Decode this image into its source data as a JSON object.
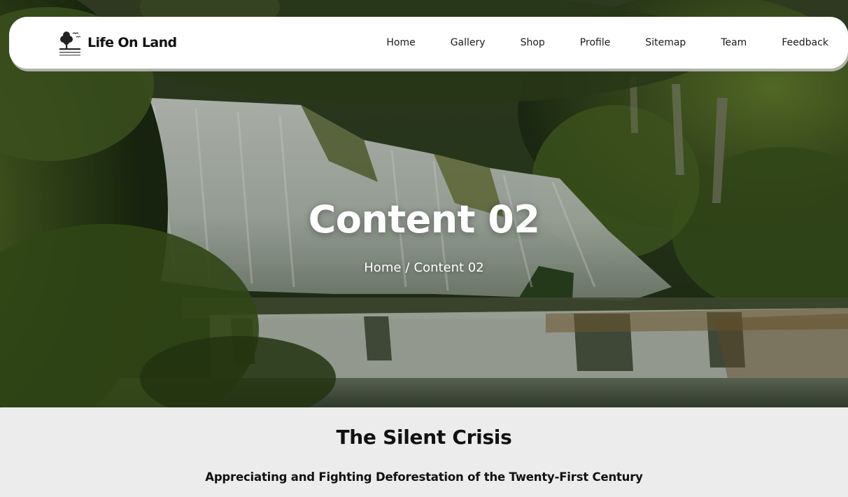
{
  "brand": {
    "name": "Life On Land",
    "logo_icon": "tree-logo-icon"
  },
  "nav": {
    "items": [
      {
        "label": "Home"
      },
      {
        "label": "Gallery"
      },
      {
        "label": "Shop"
      },
      {
        "label": "Profile"
      },
      {
        "label": "Sitemap"
      },
      {
        "label": "Team"
      },
      {
        "label": "Feedback"
      }
    ]
  },
  "hero": {
    "title": "Content 02",
    "breadcrumb": {
      "home": "Home",
      "separator": "/",
      "current": "Content 02"
    },
    "background": "waterfall-forest-image"
  },
  "section": {
    "title": "The Silent Crisis",
    "subtitle": "Appreciating and Fighting Deforestation of the Twenty-First Century"
  },
  "colors": {
    "nav_background": "#ffffff",
    "text_dark": "#111111",
    "content_background": "#ececec",
    "hero_text": "#ffffff"
  }
}
